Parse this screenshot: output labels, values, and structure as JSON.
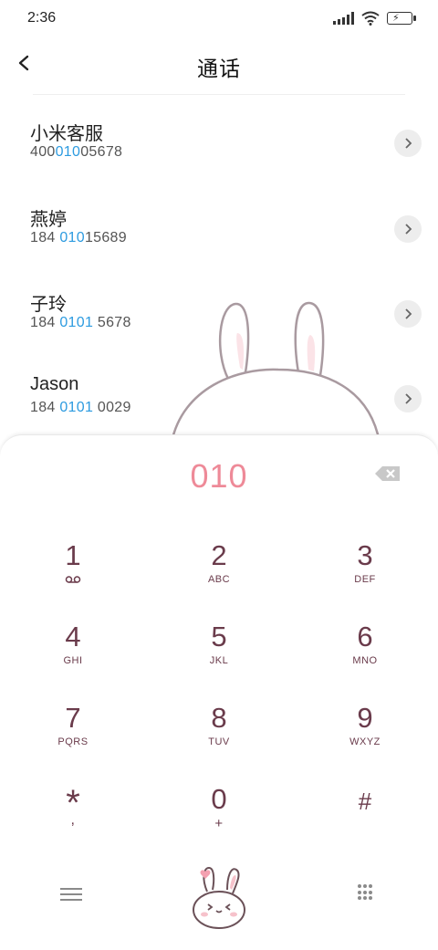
{
  "status_bar": {
    "time": "2:36"
  },
  "header": {
    "title": "通话"
  },
  "contacts": [
    {
      "name": "小米客服",
      "number_pre": "400",
      "number_match": "010",
      "number_post": "05678"
    },
    {
      "name": "燕婷",
      "number_pre": "184 ",
      "number_match": "010",
      "number_post": "15689"
    },
    {
      "name": "子玲",
      "number_pre": "184 ",
      "number_match": "0101",
      "number_post": " 5678"
    },
    {
      "name": "Jason",
      "number_pre": "184 ",
      "number_match": "0101",
      "number_post": " 0029"
    }
  ],
  "dialpad": {
    "digits": "010",
    "keys": [
      {
        "digit": "1",
        "letters": ""
      },
      {
        "digit": "2",
        "letters": "ABC"
      },
      {
        "digit": "3",
        "letters": "DEF"
      },
      {
        "digit": "4",
        "letters": "GHI"
      },
      {
        "digit": "5",
        "letters": "JKL"
      },
      {
        "digit": "6",
        "letters": "MNO"
      },
      {
        "digit": "7",
        "letters": "PQRS"
      },
      {
        "digit": "8",
        "letters": "TUV"
      },
      {
        "digit": "9",
        "letters": "WXYZ"
      },
      {
        "digit": "*",
        "letters": ","
      },
      {
        "digit": "0",
        "letters": "+"
      },
      {
        "digit": "#",
        "letters": ""
      }
    ]
  },
  "colors": {
    "highlight": "#2d9be0",
    "digits": "#ee8a98",
    "key_text": "#6a3b4b"
  },
  "icons": {
    "back": "chevron-left-icon",
    "row_action": "chevron-right-icon",
    "voicemail": "voicemail-icon",
    "backspace": "backspace-icon",
    "menu": "menu-icon",
    "dialpad_toggle": "dialpad-grid-icon",
    "call": "bunny-call-icon"
  }
}
